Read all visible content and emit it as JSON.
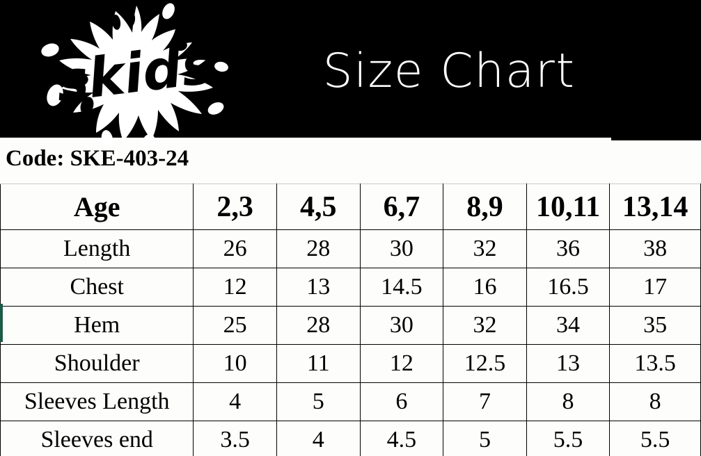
{
  "header": {
    "brand_logo": "skids-splat-logo",
    "brand_name": "skids",
    "title": "Size Chart",
    "background_color": "#000000",
    "text_color": "#ffffff"
  },
  "code": {
    "label": "Code: SKE-403-24"
  },
  "chart_data": {
    "type": "table",
    "title": "Size Chart",
    "row_header": "Age",
    "categories": [
      "2,3",
      "4,5",
      "6,7",
      "8,9",
      "10,11",
      "13,14"
    ],
    "rows": [
      {
        "label": "Length",
        "values": [
          "26",
          "28",
          "30",
          "32",
          "36",
          "38"
        ]
      },
      {
        "label": "Chest",
        "values": [
          "12",
          "13",
          "14.5",
          "16",
          "16.5",
          "17"
        ]
      },
      {
        "label": "Hem",
        "values": [
          "25",
          "28",
          "30",
          "32",
          "34",
          "35"
        ]
      },
      {
        "label": "Shoulder",
        "values": [
          "10",
          "11",
          "12",
          "12.5",
          "13",
          "13.5"
        ]
      },
      {
        "label": "Sleeves Length",
        "values": [
          "4",
          "5",
          "6",
          "7",
          "8",
          "8"
        ]
      },
      {
        "label": "Sleeves end",
        "values": [
          "3.5",
          "4",
          "4.5",
          "5",
          "5.5",
          "5.5"
        ]
      }
    ]
  },
  "table": {
    "header": [
      "Age",
      "2,3",
      "4,5",
      "6,7",
      "8,9",
      "10,11",
      "13,14"
    ],
    "rows": [
      [
        "Length",
        "26",
        "28",
        "30",
        "32",
        "36",
        "38"
      ],
      [
        "Chest",
        "12",
        "13",
        "14.5",
        "16",
        "16.5",
        "17"
      ],
      [
        "Hem",
        "25",
        "28",
        "30",
        "32",
        "34",
        "35"
      ],
      [
        "Shoulder",
        "10",
        "11",
        "12",
        "12.5",
        "13",
        "13.5"
      ],
      [
        "Sleeves Length",
        "4",
        "5",
        "6",
        "7",
        "8",
        "8"
      ],
      [
        "Sleeves end",
        "3.5",
        "4",
        "4.5",
        "5",
        "5.5",
        "5.5"
      ]
    ]
  },
  "colors": {
    "band": "#000000",
    "paper": "#fdfdfb",
    "ink": "#000000",
    "grid": "#000000",
    "edge_artifact": "#1d5a47"
  }
}
